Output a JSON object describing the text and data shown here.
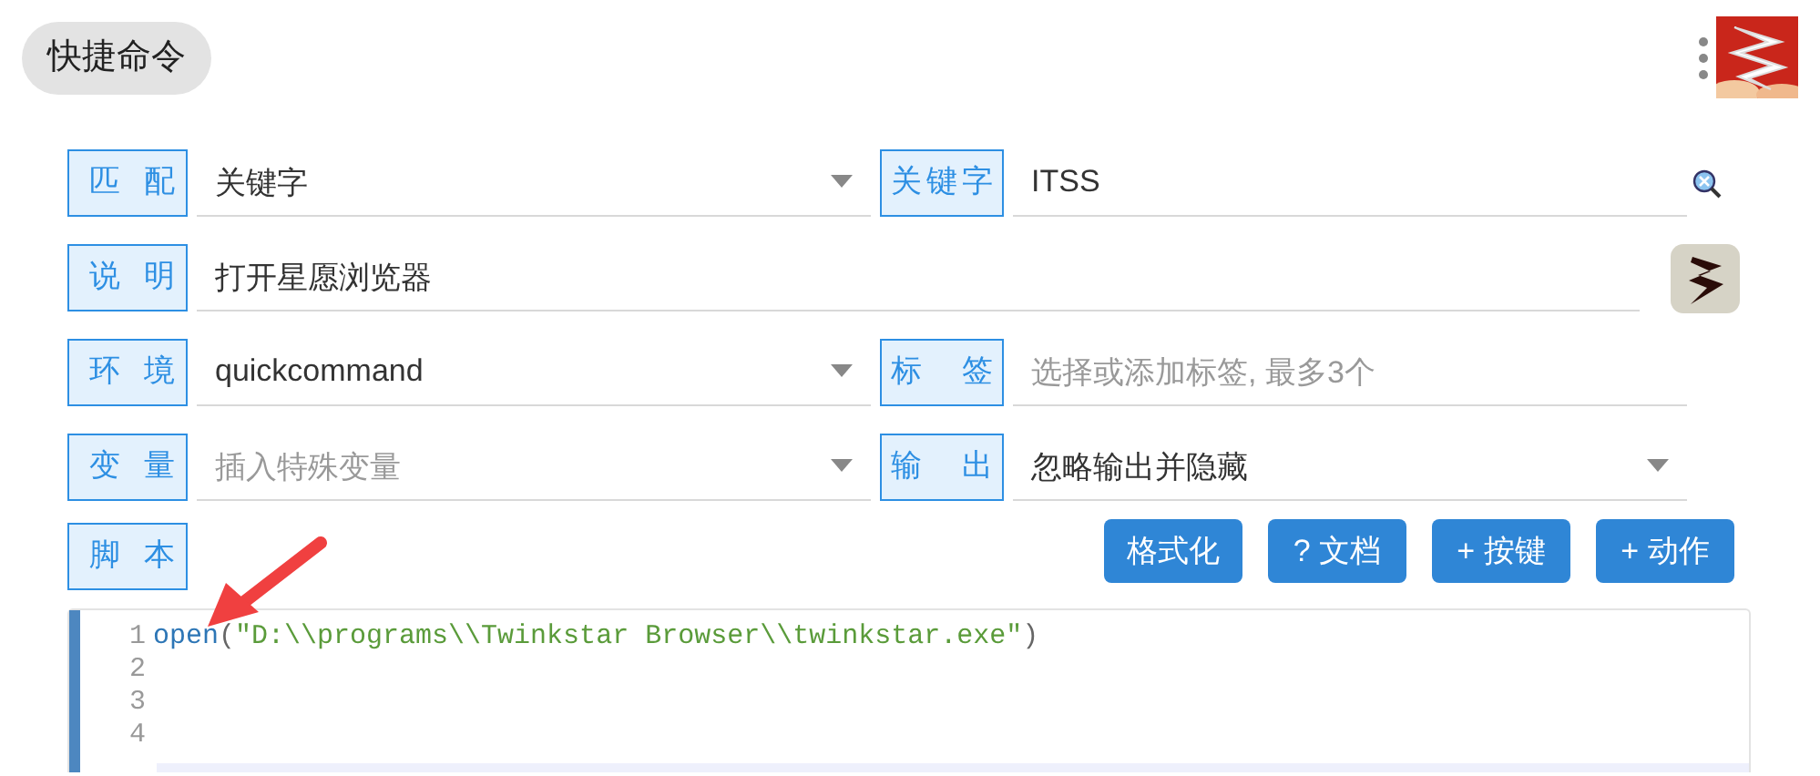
{
  "header": {
    "title": "快捷命令"
  },
  "rows": [
    {
      "label": "匹配",
      "field": {
        "kind": "select",
        "value": "关键字"
      },
      "pair": {
        "label": "关键字",
        "field": {
          "kind": "search",
          "value": "ITSS"
        }
      }
    },
    {
      "label": "说明",
      "field": {
        "kind": "wide",
        "value": "打开星愿浏览器"
      }
    },
    {
      "label": "环境",
      "field": {
        "kind": "select",
        "value": "quickcommand"
      },
      "pair": {
        "label": "标签",
        "field": {
          "kind": "text",
          "placeholder": "选择或添加标签, 最多3个"
        }
      }
    },
    {
      "label": "变量",
      "field": {
        "kind": "select",
        "placeholder": "插入特殊变量"
      },
      "pair": {
        "label": "输出",
        "field": {
          "kind": "select",
          "value": "忽略输出并隐藏"
        }
      }
    }
  ],
  "script": {
    "label": "脚本",
    "buttons": [
      "格式化",
      "? 文档",
      "+ 按键",
      "+ 动作"
    ]
  },
  "editor": {
    "lines": [
      {
        "number": "1",
        "tokens": [
          {
            "kind": "function",
            "text": "open"
          },
          {
            "kind": "punct",
            "text": "("
          },
          {
            "kind": "string",
            "text": "\"D:\\\\programs\\\\Twinkstar Browser\\\\twinkstar.exe\""
          },
          {
            "kind": "punct",
            "text": ")"
          }
        ]
      },
      {
        "number": "2"
      },
      {
        "number": "3"
      },
      {
        "number": "4"
      }
    ]
  }
}
